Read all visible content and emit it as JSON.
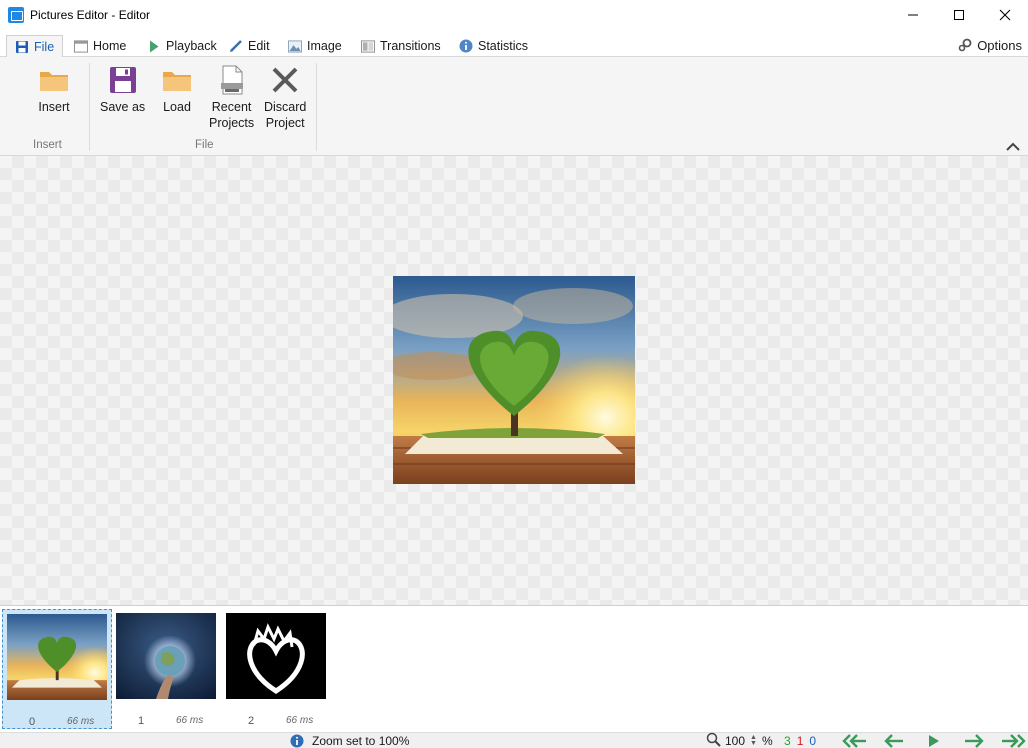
{
  "window": {
    "title": "Pictures Editor - Editor"
  },
  "tabs": [
    {
      "label": "File",
      "icon": "floppy-icon"
    },
    {
      "label": "Home",
      "icon": "home-window-icon"
    },
    {
      "label": "Playback",
      "icon": "play-icon"
    },
    {
      "label": "Edit",
      "icon": "pencil-icon"
    },
    {
      "label": "Image",
      "icon": "image-icon"
    },
    {
      "label": "Transitions",
      "icon": "transitions-icon"
    },
    {
      "label": "Statistics",
      "icon": "info-icon"
    }
  ],
  "options": {
    "label": "Options",
    "icon": "gears-icon"
  },
  "ribbon": {
    "insert_label": "Insert",
    "save_as_label": "Save as",
    "load_label": "Load",
    "recent_label_1": "Recent",
    "recent_label_2": "Projects",
    "discard_label_1": "Discard",
    "discard_label_2": "Project",
    "group_insert": "Insert",
    "group_file": "File"
  },
  "frames": [
    {
      "index": "0",
      "delay": "66 ms"
    },
    {
      "index": "1",
      "delay": "66 ms"
    },
    {
      "index": "2",
      "delay": "66 ms"
    }
  ],
  "status": {
    "message": "Zoom set to 100%",
    "zoom_value": "100",
    "zoom_unit": "%",
    "count_total": "3",
    "count_selected": "1",
    "count_current": "0"
  },
  "colors": {
    "accent": "#1a5fb4",
    "selection": "#cde6f7",
    "nav_green": "#3a9a5c",
    "count_green": "#2e9e2e",
    "count_red": "#cc2222",
    "count_blue": "#1f5fbf"
  }
}
